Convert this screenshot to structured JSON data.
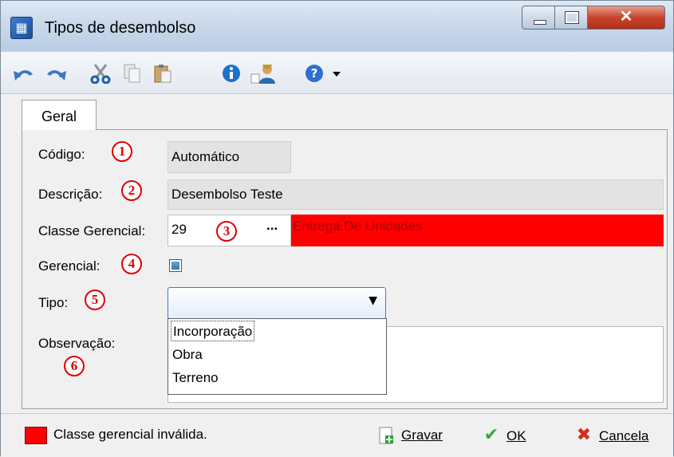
{
  "window": {
    "title": "Tipos de desembolso"
  },
  "toolbar": {
    "icons": [
      "undo-icon",
      "redo-icon",
      "cut-icon",
      "copy-icon",
      "paste-icon",
      "info-icon",
      "user-properties-icon",
      "help-icon",
      "dropdown-arrow-icon"
    ]
  },
  "tabs": [
    {
      "label": "Geral"
    }
  ],
  "form": {
    "codigo": {
      "label": "Código:",
      "marker": "1",
      "value": "Automático"
    },
    "descricao": {
      "label": "Descrição:",
      "marker": "2",
      "value": "Desembolso Teste"
    },
    "classe": {
      "label": "Classe Gerencial:",
      "marker": "3",
      "code": "29",
      "lookup": "...",
      "name": "Entrega De Unidades"
    },
    "gerencial": {
      "label": "Gerencial:",
      "marker": "4",
      "checked": true
    },
    "tipo": {
      "label": "Tipo:",
      "marker": "5",
      "value": "",
      "options": [
        "Incorporação",
        "Obra",
        "Terreno"
      ]
    },
    "observacao": {
      "label": "Observação:",
      "marker": "6",
      "value": ""
    }
  },
  "footer": {
    "legend_color": "#ff0000",
    "legend_text": "Classe gerencial inválida.",
    "buttons": {
      "gravar": "Gravar",
      "ok": "OK",
      "cancela": "Cancela"
    }
  },
  "colors": {
    "invalid": "#ff0000",
    "marker": "#e00000"
  }
}
